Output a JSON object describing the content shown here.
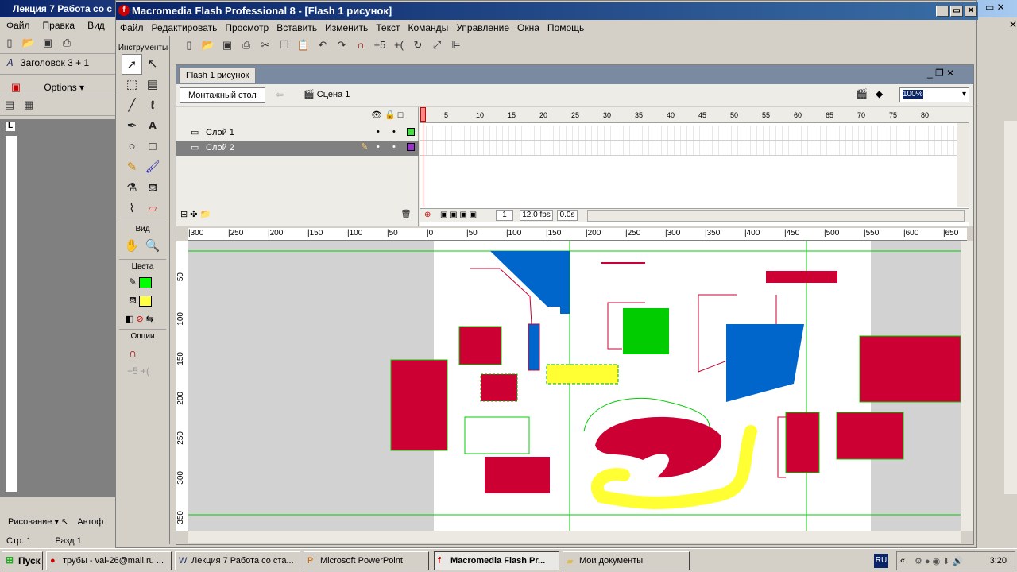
{
  "word": {
    "title": "Лекция 7 Работа со с",
    "menu": [
      "Файл",
      "Правка",
      "Вид"
    ],
    "style_box": "Заголовок 3 + 1",
    "options_label": "Options",
    "draw_label": "Рисование",
    "autoshapes_label": "Автоф",
    "status": {
      "page": "Стр. 1",
      "section": "Разд 1"
    }
  },
  "flash": {
    "title": "Macromedia Flash Professional 8 - [Flash 1 рисунок]",
    "menu": [
      "Файл",
      "Редактировать",
      "Просмотр",
      "Вставить",
      "Изменить",
      "Текст",
      "Команды",
      "Управление",
      "Окна",
      "Помощь"
    ],
    "tools": {
      "header": "Инструменты",
      "view_label": "Вид",
      "colors_label": "Цвета",
      "options_label": "Опции",
      "stroke_color": "#00ff00",
      "fill_color": "#ffff44"
    },
    "document": {
      "tab": "Flash 1 рисунок",
      "stage_button": "Монтажный стол",
      "scene": "Сцена 1",
      "zoom": "100%"
    },
    "timeline": {
      "layers": [
        {
          "name": "Слой 1",
          "color": "#44dd44"
        },
        {
          "name": "Слой 2",
          "color": "#9933cc"
        }
      ],
      "frame_numbers": [
        "1",
        "5",
        "10",
        "15",
        "20",
        "25",
        "30",
        "35",
        "40",
        "45",
        "50",
        "55",
        "60",
        "65",
        "70",
        "75",
        "80"
      ],
      "current_frame": "1",
      "fps": "12.0 fps",
      "time": "0.0s"
    },
    "rulers": {
      "h": [
        "300",
        "250",
        "200",
        "150",
        "100",
        "50",
        "0",
        "50",
        "100",
        "150",
        "200",
        "250",
        "300",
        "350",
        "400",
        "450",
        "500",
        "550",
        "600",
        "650"
      ],
      "v": [
        "50",
        "100",
        "150",
        "200",
        "250",
        "300",
        "350"
      ]
    }
  },
  "taskbar": {
    "start": "Пуск",
    "tasks": [
      "трубы - vai-26@mail.ru ...",
      "Лекция 7 Работа со ста...",
      "Microsoft PowerPoint",
      "Macromedia Flash Pr...",
      "Мои документы"
    ],
    "lang": "RU",
    "clock": "3:20"
  }
}
